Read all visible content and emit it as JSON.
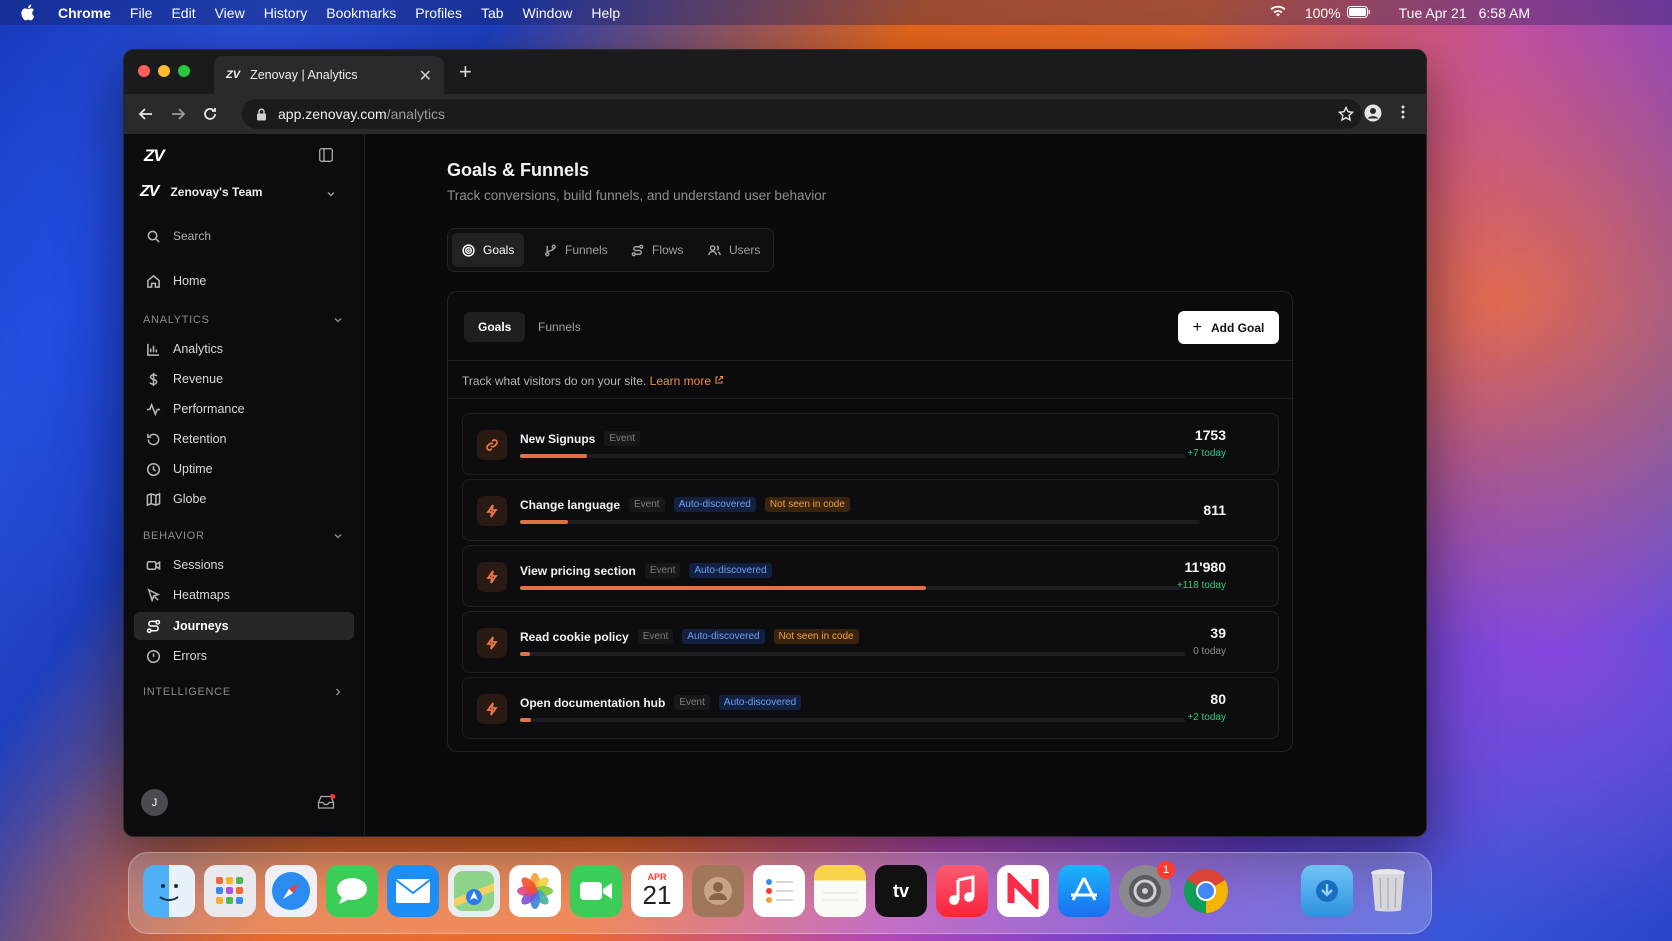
{
  "menubar": {
    "app": "Chrome",
    "items": [
      "File",
      "Edit",
      "View",
      "History",
      "Bookmarks",
      "Profiles",
      "Tab",
      "Window",
      "Help"
    ],
    "battery": "100%",
    "date": "Tue Apr 21",
    "time": "6:58 AM"
  },
  "browser": {
    "tab_favicon": "ZV",
    "tab_title": "Zenovay | Analytics",
    "url_host": "app.zenovay.com",
    "url_path": "/analytics"
  },
  "sidebar": {
    "logo": "ZV",
    "team_logo": "ZV",
    "team_name": "Zenovay's Team",
    "search": "Search",
    "home": "Home",
    "sections": {
      "analytics": "ANALYTICS",
      "behavior": "BEHAVIOR",
      "intelligence": "INTELLIGENCE"
    },
    "analytics_items": [
      "Analytics",
      "Revenue",
      "Performance",
      "Retention",
      "Uptime",
      "Globe"
    ],
    "behavior_items": [
      "Sessions",
      "Heatmaps",
      "Journeys",
      "Errors"
    ],
    "active_item": "Journeys",
    "avatar": "J"
  },
  "main": {
    "title": "Goals & Funnels",
    "subtitle": "Track conversions, build funnels, and understand user behavior",
    "tabs": [
      "Goals",
      "Funnels",
      "Flows",
      "Users"
    ],
    "card_tabs": [
      "Goals",
      "Funnels"
    ],
    "add_button": "Add Goal",
    "info_text": "Track what visitors do on your site.",
    "learn_more": "Learn more",
    "goals": [
      {
        "name": "New Signups",
        "badges": [
          "Event"
        ],
        "value": "1753",
        "today": "+7 today",
        "today_color": "green",
        "progress": 0.1
      },
      {
        "name": "Change language",
        "badges": [
          "Event",
          "Auto-discovered",
          "Not seen in code"
        ],
        "value": "811",
        "today": "",
        "today_color": "green",
        "progress": 0.07
      },
      {
        "name": "View pricing section",
        "badges": [
          "Event",
          "Auto-discovered"
        ],
        "value": "11'980",
        "today": "+118 today",
        "today_color": "green",
        "progress": 0.61
      },
      {
        "name": "Read cookie policy",
        "badges": [
          "Event",
          "Auto-discovered",
          "Not seen in code"
        ],
        "value": "39",
        "today": "0 today",
        "today_color": "grey",
        "progress": 0.015
      },
      {
        "name": "Open documentation hub",
        "badges": [
          "Event",
          "Auto-discovered"
        ],
        "value": "80",
        "today": "+2 today",
        "today_color": "green",
        "progress": 0.017
      }
    ]
  },
  "dock": {
    "calendar_month": "APR",
    "calendar_day": "21",
    "settings_badge": "1"
  }
}
